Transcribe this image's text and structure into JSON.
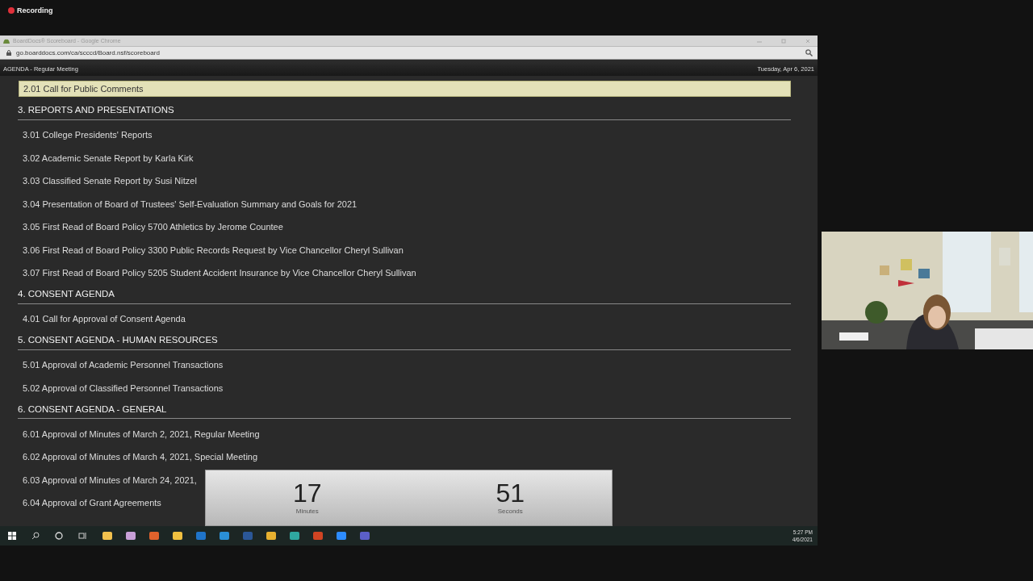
{
  "recording": {
    "label": "Recording"
  },
  "browser": {
    "title": "BoardDocs® Scoreboard - Google Chrome",
    "url": "go.boarddocs.com/ca/scccd/Board.nsf/scoreboard"
  },
  "agenda_header": {
    "title": "AGENDA - Regular Meeting",
    "date": "Tuesday, Apr 6, 2021"
  },
  "agenda": [
    {
      "kind": "item",
      "text": "2.01 Call for Public Comments",
      "selected": true
    },
    {
      "kind": "section",
      "text": "3. REPORTS AND PRESENTATIONS"
    },
    {
      "kind": "item",
      "text": "3.01 College Presidents' Reports",
      "selected": false
    },
    {
      "kind": "item",
      "text": "3.02 Academic Senate Report by Karla Kirk",
      "selected": false
    },
    {
      "kind": "item",
      "text": "3.03 Classified Senate Report by Susi Nitzel",
      "selected": false
    },
    {
      "kind": "item",
      "text": "3.04 Presentation of Board of Trustees' Self-Evaluation Summary and Goals for 2021",
      "selected": false
    },
    {
      "kind": "item",
      "text": "3.05 First Read of Board Policy 5700 Athletics by Jerome Countee",
      "selected": false
    },
    {
      "kind": "item",
      "text": "3.06 First Read of Board Policy 3300 Public Records Request by Vice Chancellor Cheryl Sullivan",
      "selected": false
    },
    {
      "kind": "item",
      "text": "3.07 First Read of Board Policy 5205 Student Accident Insurance by Vice Chancellor Cheryl Sullivan",
      "selected": false
    },
    {
      "kind": "section",
      "text": "4. CONSENT AGENDA"
    },
    {
      "kind": "item",
      "text": "4.01 Call for Approval of Consent Agenda",
      "selected": false
    },
    {
      "kind": "section",
      "text": "5. CONSENT AGENDA - HUMAN RESOURCES"
    },
    {
      "kind": "item",
      "text": "5.01 Approval of Academic Personnel Transactions",
      "selected": false
    },
    {
      "kind": "item",
      "text": "5.02 Approval of Classified Personnel Transactions",
      "selected": false
    },
    {
      "kind": "section",
      "text": "6. CONSENT AGENDA - GENERAL"
    },
    {
      "kind": "item",
      "text": "6.01 Approval of Minutes of March 2, 2021, Regular Meeting",
      "selected": false
    },
    {
      "kind": "item",
      "text": "6.02 Approval of Minutes of March 4, 2021, Special Meeting",
      "selected": false
    },
    {
      "kind": "item",
      "text": "6.03 Approval of Minutes of March 24, 2021,",
      "selected": false
    },
    {
      "kind": "item",
      "text": "6.04 Approval of Grant Agreements",
      "selected": false
    }
  ],
  "timer": [
    {
      "value": "17",
      "unit": "Minutes"
    },
    {
      "value": "51",
      "unit": "Seconds"
    }
  ],
  "taskbar": {
    "time": "5:27 PM",
    "date": "4/6/2021"
  }
}
